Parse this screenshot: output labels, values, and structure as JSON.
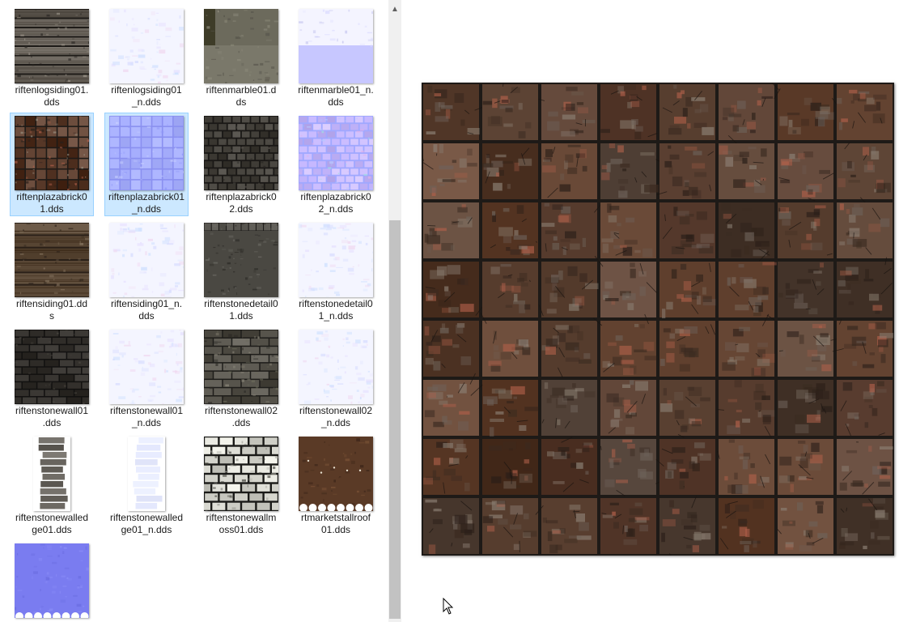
{
  "files": [
    {
      "line1": "riftenlogsiding01.",
      "line2": "dds",
      "style": "logs",
      "selected": false
    },
    {
      "line1": "riftenlogsiding01",
      "line2": "_n.dds",
      "style": "normal-pale",
      "selected": false
    },
    {
      "line1": "riftenmarble01.d",
      "line2": "ds",
      "style": "marble",
      "selected": false
    },
    {
      "line1": "riftenmarble01_n.",
      "line2": "dds",
      "style": "marble-normal",
      "selected": false
    },
    {
      "line1": "riftenplazabrick0",
      "line2": "1.dds",
      "style": "plaza",
      "selected": true
    },
    {
      "line1": "riftenplazabrick01",
      "line2": "_n.dds",
      "style": "plaza-normal",
      "selected": true
    },
    {
      "line1": "riftenplazabrick0",
      "line2": "2.dds",
      "style": "cobble",
      "selected": false
    },
    {
      "line1": "riftenplazabrick0",
      "line2": "2_n.dds",
      "style": "cobble-normal",
      "selected": false
    },
    {
      "line1": "riftensiding01.dd",
      "line2": "s",
      "style": "planks",
      "selected": false
    },
    {
      "line1": "riftensiding01_n.",
      "line2": "dds",
      "style": "normal-pale",
      "selected": false
    },
    {
      "line1": "riftenstonedetail0",
      "line2": "1.dds",
      "style": "stonedetail",
      "selected": false
    },
    {
      "line1": "riftenstonedetail0",
      "line2": "1_n.dds",
      "style": "normal-pale",
      "selected": false
    },
    {
      "line1": "riftenstonewall01",
      "line2": ".dds",
      "style": "darkbrick",
      "selected": false
    },
    {
      "line1": "riftenstonewall01",
      "line2": "_n.dds",
      "style": "normal-pale",
      "selected": false
    },
    {
      "line1": "riftenstonewall02",
      "line2": ".dds",
      "style": "stonewall",
      "selected": false
    },
    {
      "line1": "riftenstonewall02",
      "line2": "_n.dds",
      "style": "normal-pale",
      "selected": false
    },
    {
      "line1": "riftenstonewalled",
      "line2": "ge01.dds",
      "style": "edge",
      "selected": false
    },
    {
      "line1": "riftenstonewalled",
      "line2": "ge01_n.dds",
      "style": "edge-normal",
      "selected": false
    },
    {
      "line1": "riftenstonewallm",
      "line2": "oss01.dds",
      "style": "moss",
      "selected": false
    },
    {
      "line1": "rtmarketstallroof",
      "line2": "01.dds",
      "style": "roof",
      "selected": false
    },
    {
      "line1": "",
      "line2": "",
      "style": "blue-normal",
      "selected": false
    }
  ],
  "preview": {
    "style": "plaza",
    "colors": {
      "base": "#4a3326",
      "grout": "#1e1a17",
      "accent": "#b0604a"
    }
  },
  "scroll": {
    "up_glyph": "▲"
  },
  "icons": {
    "cursor": "cursor-arrow-icon",
    "scroll_up": "chevron-up-icon"
  }
}
